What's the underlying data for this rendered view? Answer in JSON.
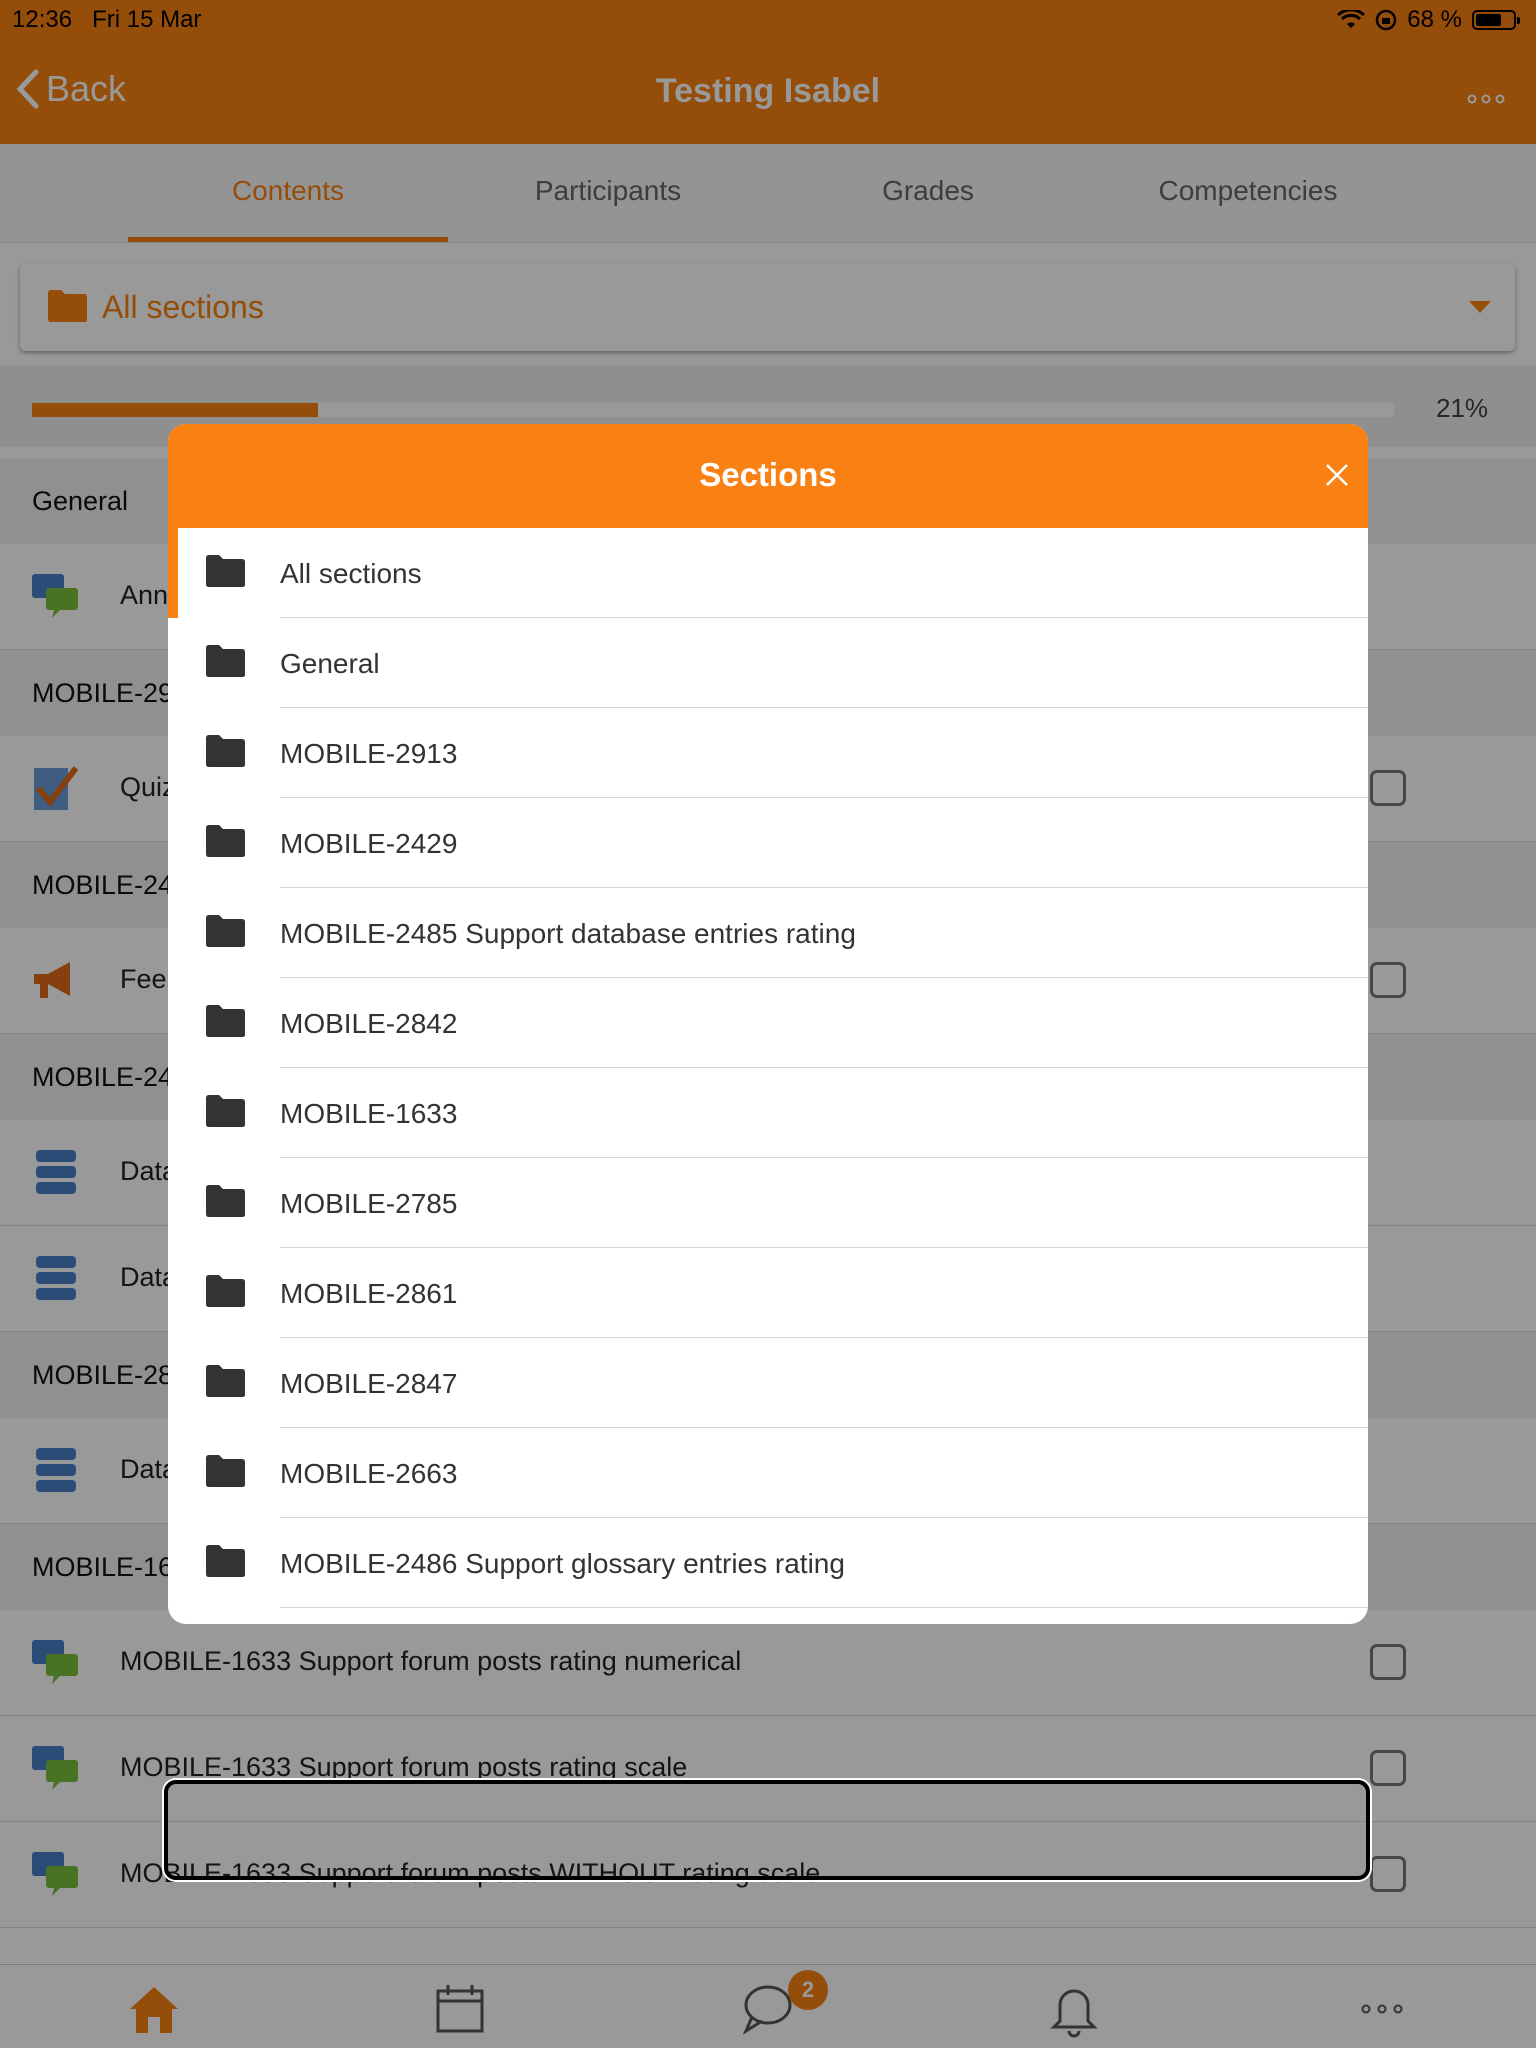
{
  "status_bar": {
    "time": "12:36",
    "date": "Fri 15 Mar",
    "battery": "68 %"
  },
  "header": {
    "back_label": "Back",
    "title": "Testing Isabel",
    "more": "..."
  },
  "tabs": [
    {
      "label": "Contents",
      "active": true
    },
    {
      "label": "Participants",
      "active": false
    },
    {
      "label": "Grades",
      "active": false
    },
    {
      "label": "Competencies",
      "active": false
    }
  ],
  "section_selector": {
    "value": "All sections"
  },
  "progress": {
    "value": 0.21,
    "label": "21%"
  },
  "background": {
    "sections": [
      "General",
      "MOBILE-29",
      "MOBILE-24",
      "MOBILE-24",
      "MOBILE-28",
      "MOBILE-16"
    ],
    "items": [
      {
        "icon": "forum-icon",
        "label": "Ann"
      },
      {
        "icon": "quiz-icon",
        "label": "Quiz"
      },
      {
        "icon": "feedback-icon",
        "label": "Fee"
      },
      {
        "icon": "database-icon",
        "label": "Data"
      },
      {
        "icon": "database-icon",
        "label": "Data"
      },
      {
        "icon": "database-icon",
        "label": "Data"
      },
      {
        "icon": "forum-icon",
        "label": "MOBILE-1633 Support forum posts rating numerical"
      },
      {
        "icon": "forum-icon",
        "label": "MOBILE-1633 Support forum posts rating scale"
      },
      {
        "icon": "forum-icon",
        "label": "MOBILE-1633 Support forum posts WITHOUT rating scale"
      }
    ]
  },
  "tab_bar": {
    "badge": "2",
    "more": "..."
  },
  "modal": {
    "title": "Sections",
    "items": [
      {
        "label": "All sections",
        "selected": true
      },
      {
        "label": "General"
      },
      {
        "label": "MOBILE-2913"
      },
      {
        "label": "MOBILE-2429"
      },
      {
        "label": "MOBILE-2485 Support database entries rating"
      },
      {
        "label": "MOBILE-2842"
      },
      {
        "label": "MOBILE-1633"
      },
      {
        "label": "MOBILE-2785"
      },
      {
        "label": "MOBILE-2861"
      },
      {
        "label": "MOBILE-2847"
      },
      {
        "label": "MOBILE-2663"
      },
      {
        "label": "MOBILE-2486 Support glossary entries rating"
      }
    ]
  },
  "colors": {
    "accent": "#f98012",
    "folder": "#333333"
  }
}
